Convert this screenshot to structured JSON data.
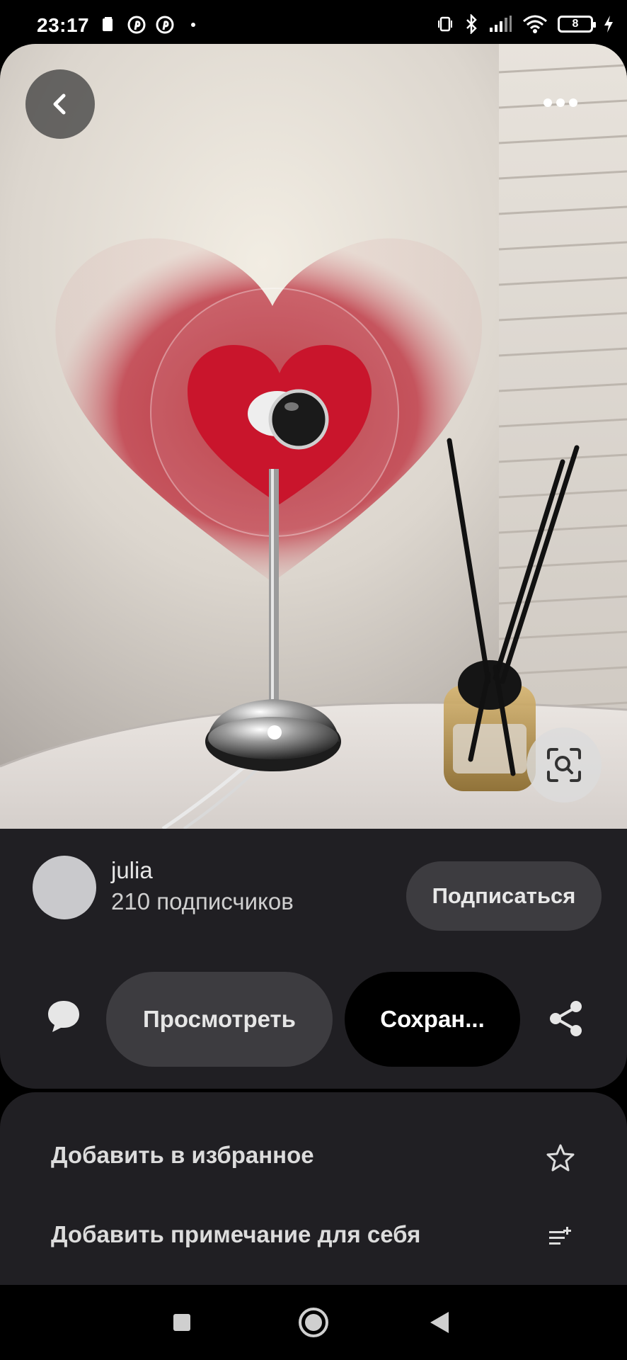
{
  "status_bar": {
    "time": "23:17",
    "battery": "8",
    "icons": [
      "notification-icon",
      "pinterest-icon",
      "pinterest-icon",
      "dot-icon",
      "vibrate-icon",
      "bluetooth-icon",
      "signal-icon",
      "wifi-icon",
      "battery-icon",
      "charging-icon"
    ]
  },
  "pin": {
    "image_icons": [
      "back-arrow-icon",
      "more-icon",
      "visual-search-icon"
    ]
  },
  "author": {
    "name": "julia",
    "followers": "210 подписчиков",
    "follow_label": "Подписаться"
  },
  "actions": {
    "view_label": "Просмотреть",
    "save_label": "Сохран...",
    "icons": [
      "comment-icon",
      "share-icon"
    ]
  },
  "menu": {
    "items": [
      {
        "label": "Добавить в избранное",
        "icon": "star-icon"
      },
      {
        "label": "Добавить примечание для себя",
        "icon": "add-note-icon"
      }
    ]
  },
  "navbar": {
    "icons": [
      "recents-icon",
      "home-icon",
      "back-icon"
    ]
  }
}
